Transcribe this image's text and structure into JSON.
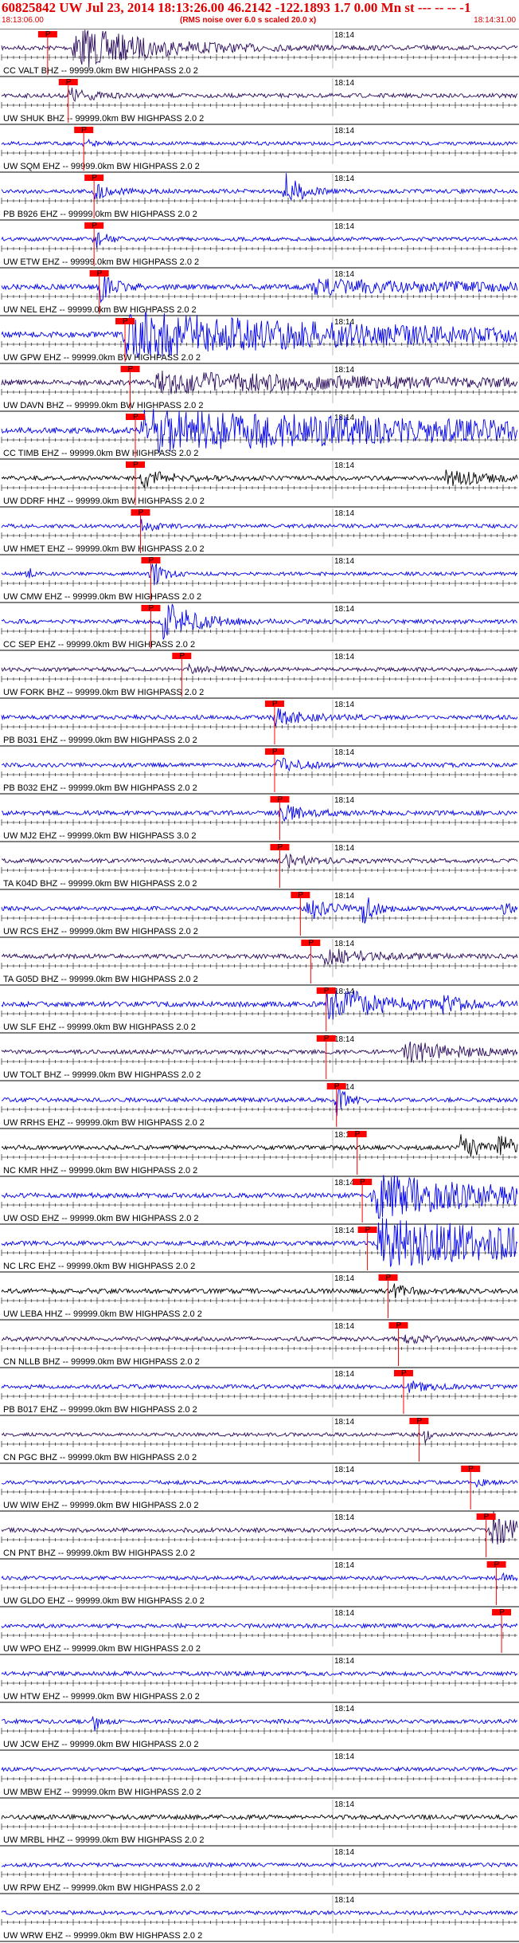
{
  "header": {
    "title": "60825842 UW Jul 23, 2014 18:13:26.00    46.2142 -122.1893  1.7 0.00 Mn st --- -- --  -1",
    "time_start": "18:13:06.00",
    "note": "(RMS noise over 6.0 s scaled 20.0 x)",
    "time_end": "18:14:31.00"
  },
  "minute_mark": "18:14",
  "pick_label": "P",
  "colors": {
    "header_text": "#e00000",
    "trace_blue": "#0000ee",
    "trace_black": "#000000",
    "trace_purple": "#2a0a5c",
    "pick": "#ff0000",
    "frame": "#000000"
  },
  "traces": [
    {
      "label": "CC VALT BHZ -- 99999.0km BW  HIGHPASS  2.0  2",
      "color": "purple",
      "pick": 0.08,
      "events": [
        {
          "t": 0.14,
          "amp": 28,
          "dur": 0.14
        }
      ],
      "noise": 0.4
    },
    {
      "label": "UW SHUK BHZ -- 99999.0km BW  HIGHPASS  2.0  2",
      "color": "purple",
      "pick": 0.12,
      "events": [
        {
          "t": 0.13,
          "amp": 10,
          "dur": 0.04
        }
      ],
      "noise": 0.35
    },
    {
      "label": "UW SQM EHZ -- 99999.0km BW  HIGHPASS  2.0  2",
      "color": "blue",
      "pick": 0.15,
      "events": [
        {
          "t": 0.16,
          "amp": 4,
          "dur": 0.03
        }
      ],
      "noise": 0.25
    },
    {
      "label": "PB B926 EHZ -- 99999.0km BW  HIGHPASS  2.0  2",
      "color": "blue",
      "pick": 0.17,
      "events": [
        {
          "t": 0.55,
          "amp": 22,
          "dur": 0.03
        },
        {
          "t": 0.18,
          "amp": 10,
          "dur": 0.03
        }
      ],
      "noise": 0.35
    },
    {
      "label": "UW ETW EHZ -- 99999.0km BW  HIGHPASS  2.0  2",
      "color": "blue",
      "pick": 0.17,
      "events": [
        {
          "t": 0.18,
          "amp": 14,
          "dur": 0.02
        }
      ],
      "noise": 0.3
    },
    {
      "label": "UW NEL EHZ -- 99999.0km BW  HIGHPASS  2.0  2",
      "color": "blue",
      "pick": 0.18,
      "events": [
        {
          "t": 0.19,
          "amp": 18,
          "dur": 0.03
        },
        {
          "t": 0.6,
          "amp": 8,
          "dur": 0.4
        }
      ],
      "noise": 0.5
    },
    {
      "label": "UW GPW EHZ -- 99999.0km BW  HIGHPASS  2.0  2",
      "color": "blue",
      "pick": 0.23,
      "events": [
        {
          "t": 0.24,
          "amp": 28,
          "dur": 0.5
        }
      ],
      "noise": 0.6
    },
    {
      "label": "UW DAVN BHZ -- 99999.0km BW  HIGHPASS  2.0  2",
      "color": "purple",
      "pick": 0.24,
      "events": [
        {
          "t": 0.3,
          "amp": 12,
          "dur": 0.5
        }
      ],
      "noise": 0.5
    },
    {
      "label": "CC TIMB EHZ -- 99999.0km BW  HIGHPASS  2.0  2",
      "color": "blue",
      "pick": 0.25,
      "events": [
        {
          "t": 0.27,
          "amp": 26,
          "dur": 0.7
        }
      ],
      "noise": 0.6
    },
    {
      "label": "UW DDRF HHZ -- 99999.0km BW  HIGHPASS  2.0  2",
      "color": "black",
      "pick": 0.25,
      "events": [
        {
          "t": 0.27,
          "amp": 10,
          "dur": 0.06
        },
        {
          "t": 0.86,
          "amp": 10,
          "dur": 0.08
        }
      ],
      "noise": 0.4
    },
    {
      "label": "UW HMET EHZ -- 99999.0km BW  HIGHPASS  2.0  2",
      "color": "blue",
      "pick": 0.26,
      "events": [
        {
          "t": 0.27,
          "amp": 8,
          "dur": 0.03
        }
      ],
      "noise": 0.3
    },
    {
      "label": "UW CMW EHZ -- 99999.0km BW  HIGHPASS  2.0  2",
      "color": "blue",
      "pick": 0.28,
      "events": [
        {
          "t": 0.29,
          "amp": 22,
          "dur": 0.02
        },
        {
          "t": 0.05,
          "amp": 10,
          "dur": 0.01
        }
      ],
      "noise": 0.25
    },
    {
      "label": "CC SEP EHZ -- 99999.0km BW  HIGHPASS  2.0  2",
      "color": "blue",
      "pick": 0.28,
      "events": [
        {
          "t": 0.31,
          "amp": 28,
          "dur": 0.06
        }
      ],
      "noise": 0.35
    },
    {
      "label": "UW FORK BHZ -- 99999.0km BW  HIGHPASS  2.0  2",
      "color": "purple",
      "pick": 0.34,
      "events": [
        {
          "t": 0.36,
          "amp": 5,
          "dur": 0.05
        }
      ],
      "noise": 0.3
    },
    {
      "label": "PB B031 EHZ -- 99999.0km BW  HIGHPASS  2.0  2",
      "color": "blue",
      "pick": 0.52,
      "events": [
        {
          "t": 0.53,
          "amp": 10,
          "dur": 0.06
        }
      ],
      "noise": 0.35
    },
    {
      "label": "PB B032 EHZ -- 99999.0km BW  HIGHPASS  2.0  2",
      "color": "blue",
      "pick": 0.52,
      "events": [
        {
          "t": 0.53,
          "amp": 9,
          "dur": 0.05
        }
      ],
      "noise": 0.35
    },
    {
      "label": "UW MJ2 EHZ -- 99999.0km BW  HIGHPASS  3.0  2",
      "color": "blue",
      "pick": 0.53,
      "events": [
        {
          "t": 0.54,
          "amp": 10,
          "dur": 0.05
        }
      ],
      "noise": 0.4
    },
    {
      "label": "TA K04D BHZ -- 99999.0km BW  HIGHPASS  2.0  2",
      "color": "purple",
      "pick": 0.53,
      "events": [
        {
          "t": 0.55,
          "amp": 8,
          "dur": 0.05
        }
      ],
      "noise": 0.35
    },
    {
      "label": "UW RCS EHZ -- 99999.0km BW  HIGHPASS  2.0  2",
      "color": "blue",
      "pick": 0.57,
      "events": [
        {
          "t": 0.59,
          "amp": 16,
          "dur": 0.04
        },
        {
          "t": 0.7,
          "amp": 20,
          "dur": 0.02
        },
        {
          "t": 0.97,
          "amp": 8,
          "dur": 0.02
        }
      ],
      "noise": 0.35
    },
    {
      "label": "TA G05D BHZ -- 99999.0km BW  HIGHPASS  2.0  2",
      "color": "purple",
      "pick": 0.59,
      "events": [
        {
          "t": 0.62,
          "amp": 10,
          "dur": 0.1
        }
      ],
      "noise": 0.4
    },
    {
      "label": "UW SLF EHZ -- 99999.0km BW  HIGHPASS  2.0  2",
      "color": "blue",
      "pick": 0.62,
      "events": [
        {
          "t": 0.63,
          "amp": 24,
          "dur": 0.1
        },
        {
          "t": 0.85,
          "amp": 8,
          "dur": 0.05
        }
      ],
      "noise": 0.5
    },
    {
      "label": "UW TOLT BHZ -- 99999.0km BW  HIGHPASS  2.0  2",
      "color": "purple",
      "pick": 0.62,
      "events": [
        {
          "t": 0.78,
          "amp": 14,
          "dur": 0.1
        }
      ],
      "noise": 0.35
    },
    {
      "label": "UW RRHS EHZ -- 99999.0km BW  HIGHPASS  2.0  2",
      "color": "blue",
      "pick": 0.64,
      "events": [
        {
          "t": 0.65,
          "amp": 18,
          "dur": 0.02
        }
      ],
      "noise": 0.35
    },
    {
      "label": "NC KMR HHZ -- 99999.0km BW  HIGHPASS  2.0  2",
      "color": "black",
      "pick": 0.68,
      "events": [
        {
          "t": 0.89,
          "amp": 16,
          "dur": 0.04
        },
        {
          "t": 0.96,
          "amp": 14,
          "dur": 0.04
        }
      ],
      "noise": 0.4
    },
    {
      "label": "UW OSD EHZ -- 99999.0km BW  HIGHPASS  2.0  2",
      "color": "blue",
      "pick": 0.69,
      "events": [
        {
          "t": 0.72,
          "amp": 28,
          "dur": 0.25
        }
      ],
      "noise": 0.45
    },
    {
      "label": "NC LRC EHZ -- 99999.0km BW  HIGHPASS  2.0  2",
      "color": "blue",
      "pick": 0.7,
      "events": [
        {
          "t": 0.73,
          "amp": 30,
          "dur": 0.5
        }
      ],
      "noise": 0.4
    },
    {
      "label": "UW LEBA HHZ -- 99999.0km BW  HIGHPASS  2.0  2",
      "color": "black",
      "pick": 0.74,
      "events": [
        {
          "t": 0.76,
          "amp": 8,
          "dur": 0.03
        }
      ],
      "noise": 0.45
    },
    {
      "label": "CN NLLB BHZ -- 99999.0km BW  HIGHPASS  2.0  2",
      "color": "purple",
      "pick": 0.76,
      "events": [
        {
          "t": 0.78,
          "amp": 6,
          "dur": 0.04
        }
      ],
      "noise": 0.35
    },
    {
      "label": "PB B017 EHZ -- 99999.0km BW  HIGHPASS  2.0  2",
      "color": "blue",
      "pick": 0.77,
      "events": [
        {
          "t": 0.79,
          "amp": 6,
          "dur": 0.04
        }
      ],
      "noise": 0.35
    },
    {
      "label": "CN PGC BHZ -- 99999.0km BW  HIGHPASS  2.0  2",
      "color": "purple",
      "pick": 0.8,
      "events": [
        {
          "t": 0.82,
          "amp": 10,
          "dur": 0.01
        }
      ],
      "noise": 0.25
    },
    {
      "label": "UW WIW EHZ -- 99999.0km BW  HIGHPASS  2.0  2",
      "color": "blue",
      "pick": 0.9,
      "events": [
        {
          "t": 0.92,
          "amp": 4,
          "dur": 0.02
        }
      ],
      "noise": 0.3
    },
    {
      "label": "CN PNT BHZ -- 99999.0km BW  HIGHPASS  2.0  2",
      "color": "purple",
      "pick": 0.93,
      "events": [
        {
          "t": 0.95,
          "amp": 24,
          "dur": 0.05
        }
      ],
      "noise": 0.35
    },
    {
      "label": "UW GLDO EHZ -- 99999.0km BW  HIGHPASS  2.0  2",
      "color": "blue",
      "pick": 0.95,
      "events": [
        {
          "t": 0.97,
          "amp": 4,
          "dur": 0.02
        }
      ],
      "noise": 0.3
    },
    {
      "label": "UW WPO EHZ -- 99999.0km BW  HIGHPASS  2.0  2",
      "color": "blue",
      "pick": 0.96,
      "events": [],
      "noise": 0.35
    },
    {
      "label": "UW HTW EHZ -- 99999.0km BW  HIGHPASS  2.0  2",
      "color": "blue",
      "pick": null,
      "events": [],
      "noise": 0.35
    },
    {
      "label": "UW JCW EHZ -- 99999.0km BW  HIGHPASS  2.0  2",
      "color": "blue",
      "pick": null,
      "events": [
        {
          "t": 0.18,
          "amp": 16,
          "dur": 0.01
        }
      ],
      "noise": 0.35
    },
    {
      "label": "UW MBW EHZ -- 99999.0km BW  HIGHPASS  2.0  2",
      "color": "blue",
      "pick": null,
      "events": [],
      "noise": 0.3
    },
    {
      "label": "UW MRBL HHZ -- 99999.0km BW  HIGHPASS  2.0  2",
      "color": "black",
      "pick": null,
      "events": [],
      "noise": 0.4
    },
    {
      "label": "UW RPW EHZ -- 99999.0km BW  HIGHPASS  2.0  2",
      "color": "blue",
      "pick": null,
      "events": [],
      "noise": 0.3
    },
    {
      "label": "UW WRW EHZ -- 99999.0km BW  HIGHPASS  2.0  2",
      "color": "blue",
      "pick": null,
      "events": [],
      "noise": 0.3
    }
  ]
}
